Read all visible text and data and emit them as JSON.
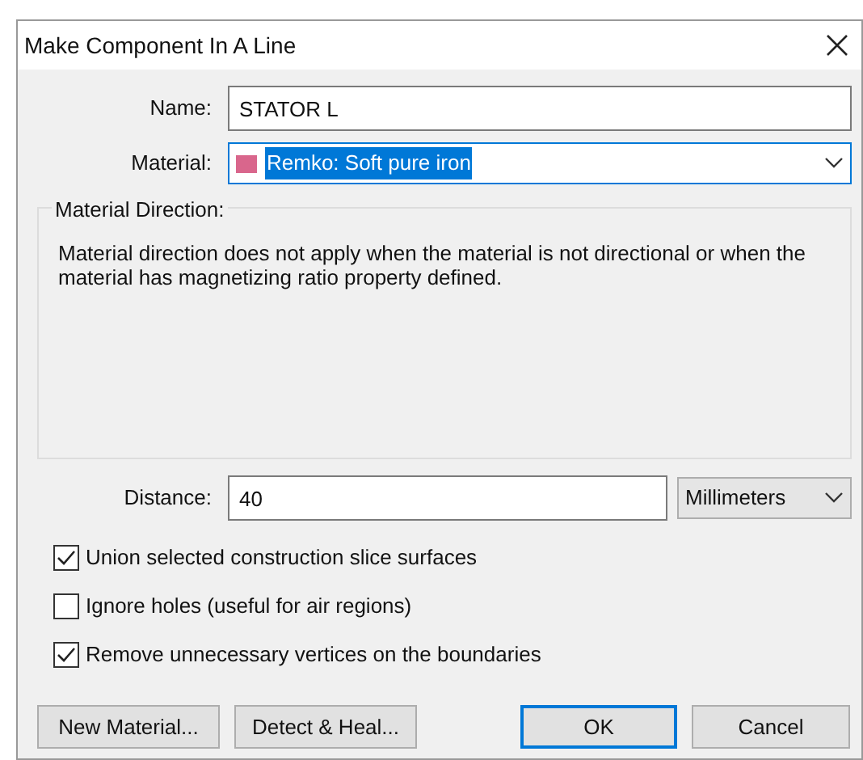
{
  "window": {
    "title": "Make Component In A Line"
  },
  "name": {
    "label": "Name:",
    "value": "STATOR L"
  },
  "material": {
    "label": "Material:",
    "value": "Remko: Soft pure iron",
    "color": "#d9668c",
    "selected": true
  },
  "direction": {
    "title": "Material Direction:",
    "note": "Material direction does not apply when the material is not directional or when the material has magnetizing ratio property defined."
  },
  "distance": {
    "label": "Distance:",
    "value": "40",
    "unit": "Millimeters"
  },
  "options": [
    {
      "label": "Union selected construction slice surfaces",
      "checked": true
    },
    {
      "label": "Ignore holes (useful for air regions)",
      "checked": false
    },
    {
      "label": "Remove unnecessary vertices on the boundaries",
      "checked": true
    }
  ],
  "buttons": [
    {
      "label": "New Material...",
      "default": false
    },
    {
      "label": "Detect & Heal...",
      "default": false
    },
    {
      "label": "OK",
      "default": true
    },
    {
      "label": "Cancel",
      "default": false
    }
  ]
}
